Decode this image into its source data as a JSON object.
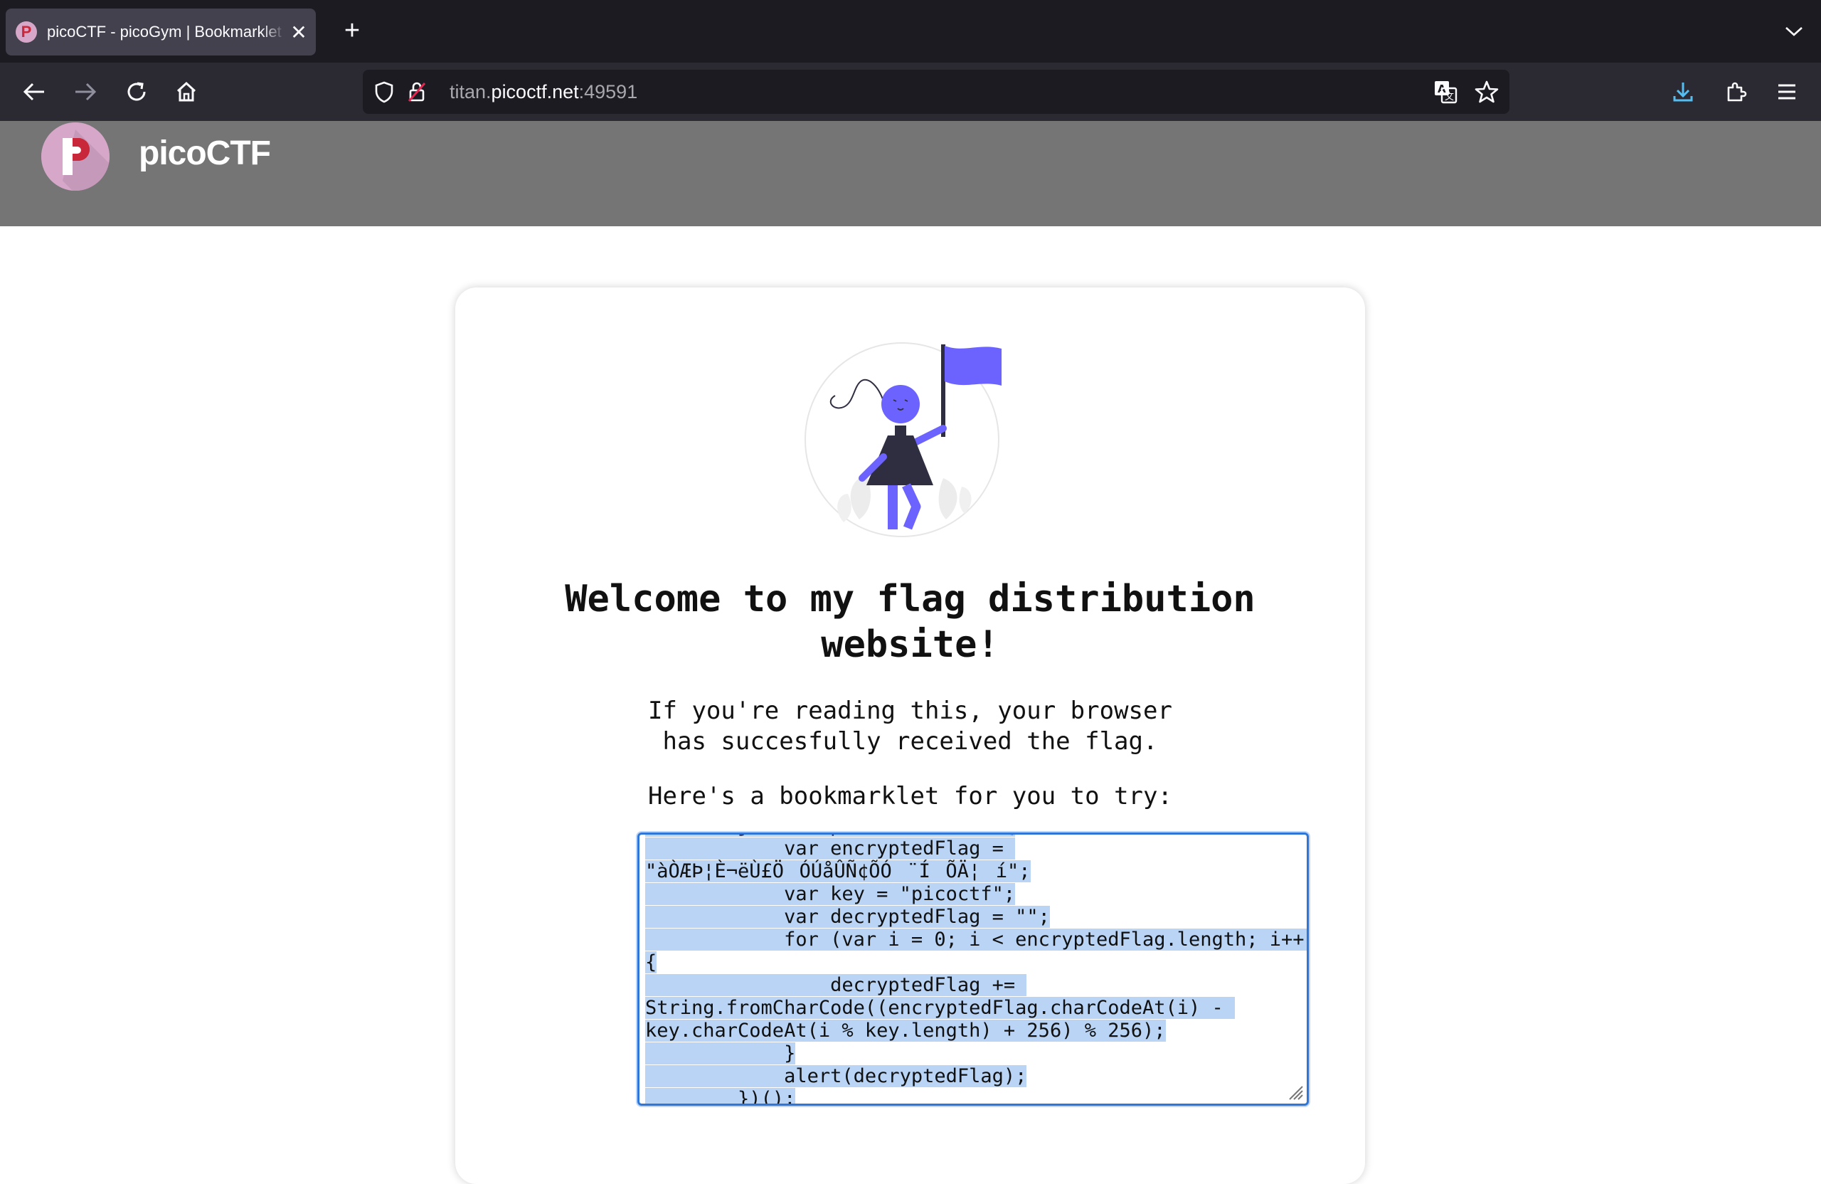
{
  "browser": {
    "tab": {
      "title": "picoCTF - picoGym | Bookmarklet",
      "favicon_letter": "P"
    },
    "url": {
      "prefix": "titan.",
      "domain": "picoctf.net",
      "suffix": ":49591"
    },
    "icons": [
      "back-icon",
      "forward-icon",
      "reload-icon",
      "home-icon",
      "shield-icon",
      "lock-icon",
      "translate-icon",
      "star-icon",
      "download-icon",
      "extensions-icon",
      "menu-icon",
      "new-tab-icon",
      "tab-list-icon",
      "close-icon"
    ]
  },
  "site": {
    "logo_letter": "P",
    "name": "picoCTF"
  },
  "content": {
    "headline_line1": "Welcome to my flag distribution",
    "headline_line2": "website!",
    "para_line1": "If you're reading this, your browser",
    "para_line2": "has succesfully received the flag.",
    "bookmarklet_intro": "Here's a bookmarklet for you to try:",
    "code_lines": [
      "        javascript:(function() {",
      "            var encryptedFlag = ",
      "\"àÒÆÞ¦È¬ëÙ£ÖÓÚåÛÑ¢ÕÓ¨ÍÕÄ¦í\";",
      "            var key = \"picoctf\";",
      "            var decryptedFlag = \"\";",
      "            for (var i = 0; i < encryptedFlag.length; i++) ",
      "{",
      "                decryptedFlag += ",
      "String.fromCharCode((encryptedFlag.charCodeAt(i) - ",
      "key.charCodeAt(i % key.length) + 256) % 256);",
      "            }",
      "            alert(decryptedFlag);",
      "        })();"
    ]
  },
  "colors": {
    "accent": "#6c63ff",
    "header_gray": "#757575",
    "selection": "#b9d4f5",
    "focus_border": "#2f76d6"
  }
}
